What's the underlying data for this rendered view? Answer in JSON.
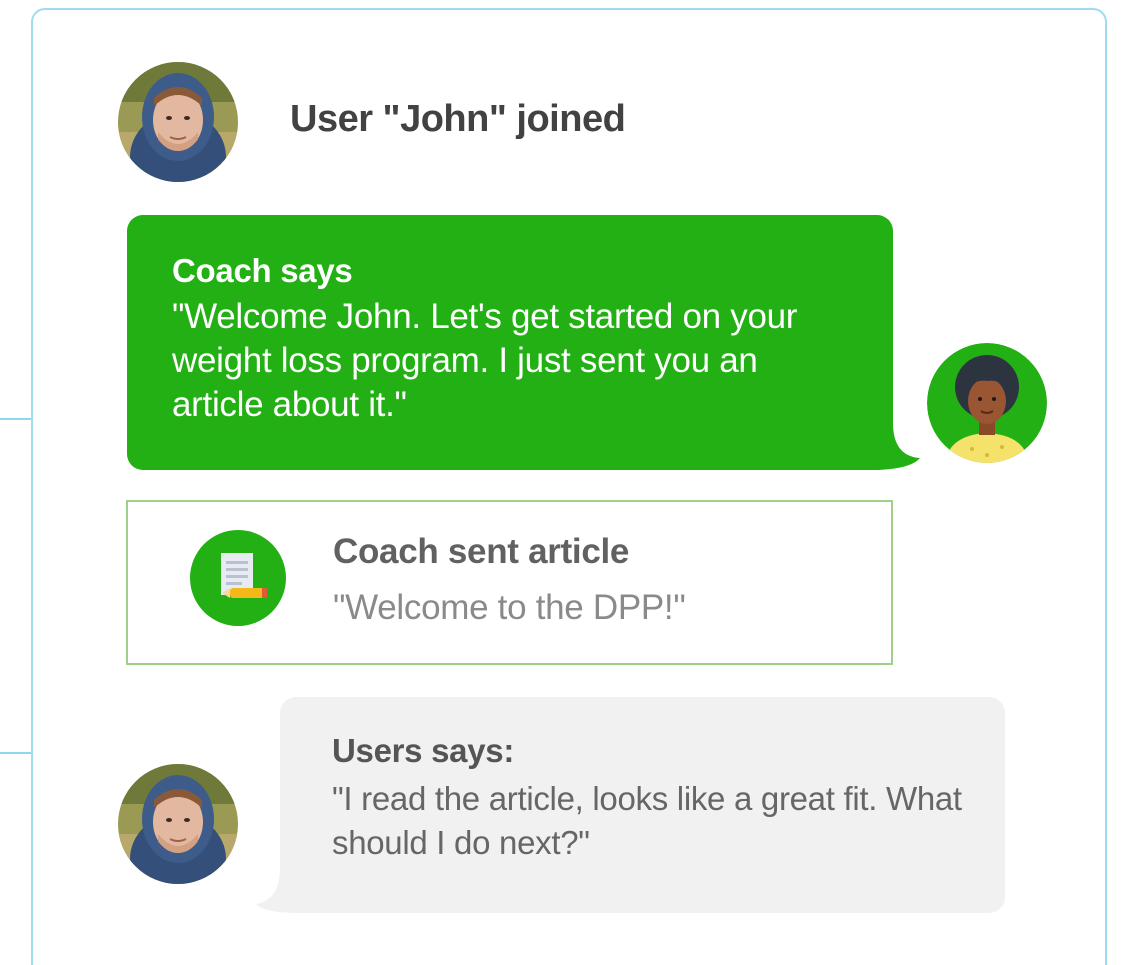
{
  "events": {
    "joined": {
      "text": "User \"John\" joined",
      "avatar": "john-avatar"
    },
    "coach_message": {
      "title": "Coach says",
      "message": "\"Welcome John. Let's get started on your weight loss program. I just sent you an article about it.\"",
      "avatar": "coach-avatar"
    },
    "article": {
      "title": "Coach sent article",
      "subtitle": "\"Welcome to the DPP!\"",
      "icon": "document-icon"
    },
    "user_message": {
      "title": "Users says:",
      "message": "\"I read the article, looks like a great fit. What should I do next?\"",
      "avatar": "john-avatar"
    }
  },
  "colors": {
    "coach_green": "#22b014",
    "panel_border": "#9fdcf2",
    "article_border": "#9ed08a",
    "user_bubble": "#f1f1f1"
  }
}
